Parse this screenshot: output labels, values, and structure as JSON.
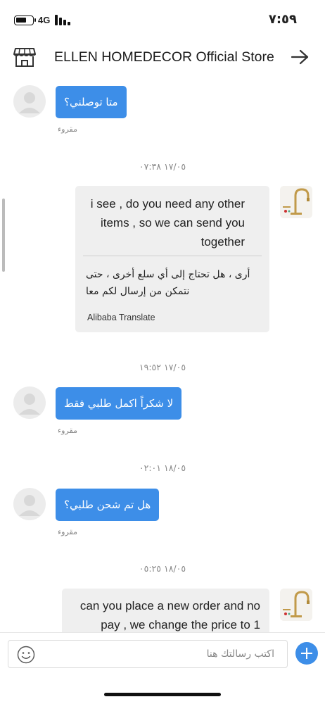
{
  "status_bar": {
    "network": "4G",
    "time": "٧:٥٩"
  },
  "header": {
    "store_name": "ELLEN HOMEDECOR Official Store",
    "store_icon": "storefront-icon",
    "forward_icon": "arrow-right-icon"
  },
  "messages": [
    {
      "type": "outgoing",
      "text": "متا توصلني؟",
      "status": "مقروء"
    },
    {
      "type": "timestamp",
      "text": "١٧/٠٥ ٠٧:٣٨"
    },
    {
      "type": "incoming",
      "original": [
        "i see , do you need any other",
        "items , so we can send you",
        "together"
      ],
      "translation": [
        "أرى ، هل تحتاج إلى أي سلع أخرى ، حتى",
        "نتمكن من إرسال لكم معا"
      ],
      "translator": "Alibaba Translate"
    },
    {
      "type": "timestamp",
      "text": "١٧/٠٥ ١٩:٥٢"
    },
    {
      "type": "outgoing",
      "text": "لا شكراً اكمل طلبي فقط",
      "status": "مقروء"
    },
    {
      "type": "timestamp",
      "text": "١٨/٠٥ ٠٢:٠١"
    },
    {
      "type": "outgoing",
      "text": "هل تم شحن طلبي؟",
      "status": "مقروء"
    },
    {
      "type": "timestamp",
      "text": "١٨/٠٥ ٠٥:٢٥"
    },
    {
      "type": "incoming",
      "original": [
        "can you place a new order and no",
        "pay , we change the price to 1"
      ]
    }
  ],
  "input": {
    "placeholder": "اكتب رسالتك هنا",
    "emoji_icon": "smiley-icon",
    "add_icon": "plus-icon"
  },
  "colors": {
    "accent": "#3d8ee8",
    "incoming_bubble": "#efefef"
  }
}
